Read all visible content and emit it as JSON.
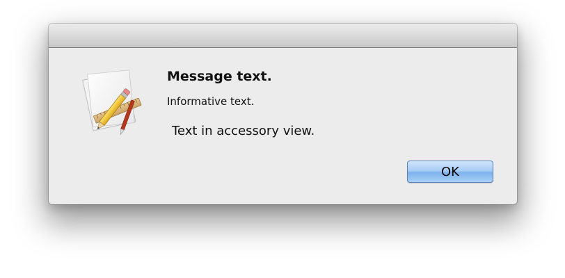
{
  "alert": {
    "message_text": "Message text.",
    "informative_text": "Informative text.",
    "accessory_text": "Text in accessory view.",
    "icon": "text-edit-app-icon",
    "ok_label": "OK"
  },
  "colors": {
    "window_background": "#ececec",
    "button_blue": "#7fb2ee"
  }
}
